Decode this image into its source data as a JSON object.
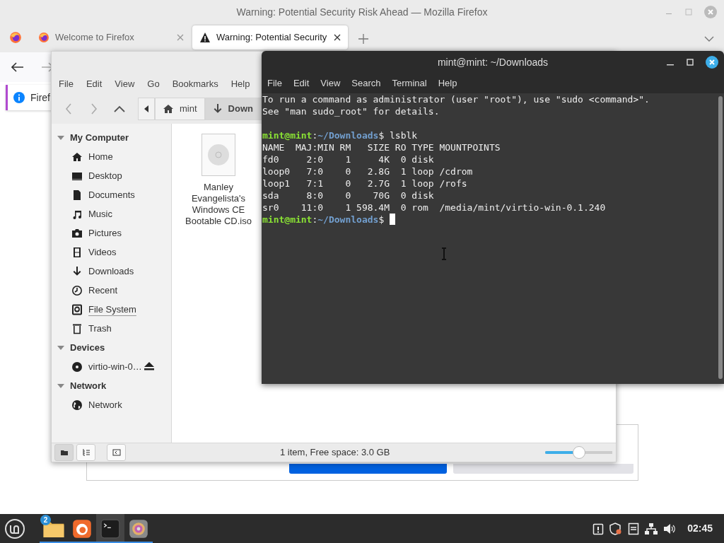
{
  "firefox": {
    "title": "Warning: Potential Security Risk Ahead — Mozilla Firefox",
    "tabs": [
      {
        "kind": "pinned",
        "selected": false
      },
      {
        "kind": "page",
        "label": "Welcome to Firefox",
        "selected": false
      },
      {
        "kind": "warning",
        "label": "Warning: Potential Security",
        "selected": true
      }
    ],
    "notification": "Firef",
    "buttons": [
      {
        "kind": "primary"
      },
      {
        "kind": "secondary"
      }
    ]
  },
  "file_manager": {
    "menu": [
      "File",
      "Edit",
      "View",
      "Go",
      "Bookmarks",
      "Help"
    ],
    "path": [
      {
        "label": "mint",
        "selected": false
      },
      {
        "label": "Down",
        "selected": true
      }
    ],
    "sidebar": [
      {
        "heading": "My Computer",
        "expanded": true,
        "items": [
          {
            "label": "Home",
            "hovered": false
          },
          {
            "label": "Desktop",
            "hovered": false
          },
          {
            "label": "Documents",
            "hovered": false
          },
          {
            "label": "Music",
            "hovered": false
          },
          {
            "label": "Pictures",
            "hovered": false
          },
          {
            "label": "Videos",
            "hovered": false
          },
          {
            "label": "Downloads",
            "hovered": false
          },
          {
            "label": "Recent",
            "hovered": false
          },
          {
            "label": "File System",
            "hovered": true
          },
          {
            "label": "Trash",
            "hovered": false
          }
        ]
      },
      {
        "heading": "Devices",
        "expanded": true,
        "items": [
          {
            "label": "virtio-win-0…",
            "hovered": false,
            "ejectable": true
          }
        ]
      },
      {
        "heading": "Network",
        "expanded": true,
        "items": [
          {
            "label": "Network",
            "hovered": false
          }
        ]
      }
    ],
    "files": [
      {
        "name": "Manley Evangelista's Windows CE Bootable CD.iso",
        "selected": false
      }
    ],
    "view_buttons": [
      {
        "selected": true
      },
      {
        "selected": false
      }
    ],
    "status": "1 item, Free space: 3.0 GB",
    "zoom": {
      "level": 0.5
    }
  },
  "terminal": {
    "title": "mint@mint: ~/Downloads",
    "menu": [
      "File",
      "Edit",
      "View",
      "Search",
      "Terminal",
      "Help"
    ],
    "lines": [
      {
        "kind": "output",
        "text": "To run a command as administrator (user \"root\"), use \"sudo <command>\"."
      },
      {
        "kind": "output",
        "text": "See \"man sudo_root\" for details."
      },
      {
        "kind": "blank"
      },
      {
        "kind": "prompt",
        "user": "mint@mint",
        "sep": ":",
        "path": "~/Downloads",
        "symbol": "$",
        "command": "lsblk",
        "cursor": false
      },
      {
        "kind": "output",
        "text": "NAME  MAJ:MIN RM   SIZE RO TYPE MOUNTPOINTS"
      },
      {
        "kind": "output",
        "text": "fd0     2:0    1     4K  0 disk"
      },
      {
        "kind": "output",
        "text": "loop0   7:0    0   2.8G  1 loop /cdrom"
      },
      {
        "kind": "output",
        "text": "loop1   7:1    0   2.7G  1 loop /rofs"
      },
      {
        "kind": "output",
        "text": "sda     8:0    0    70G  0 disk"
      },
      {
        "kind": "output",
        "text": "sr0    11:0    1 598.4M  0 rom  /media/mint/virtio-win-0.1.240"
      },
      {
        "kind": "prompt",
        "user": "mint@mint",
        "sep": ":",
        "path": "~/Downloads",
        "symbol": "$",
        "cursor": true
      }
    ]
  },
  "taskbar": {
    "apps": [
      {
        "badge": "2",
        "running": true,
        "selected": false
      },
      {
        "running": true,
        "selected": false
      },
      {
        "running": true,
        "selected": true
      },
      {
        "running": true,
        "selected": false
      }
    ],
    "clock": "02:45"
  }
}
